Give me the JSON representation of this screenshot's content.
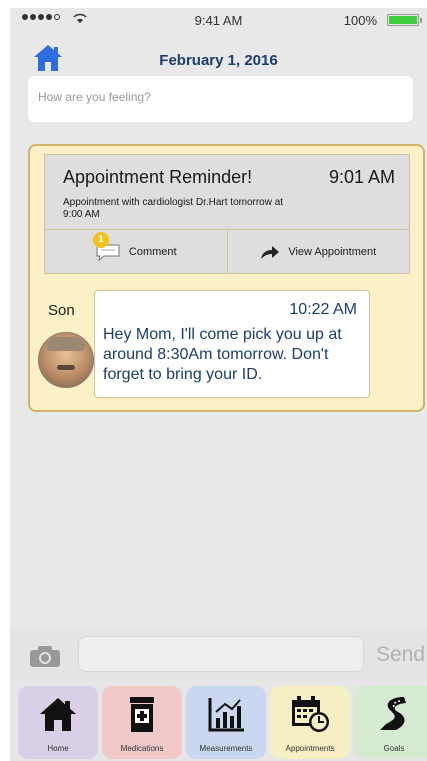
{
  "status_bar": {
    "time": "9:41 AM",
    "battery_pct": "100%",
    "battery_level": 1.0
  },
  "header": {
    "date": "February 1, 2016"
  },
  "feeling_input": {
    "placeholder": "How are you feeling?"
  },
  "reminder_card": {
    "title": "Appointment Reminder!",
    "time": "9:01 AM",
    "body": "Appointment with cardiologist Dr.Hart tomorrow at 9:00 AM",
    "comment_label": "Comment",
    "comment_badge": "1",
    "view_label": "View Appointment"
  },
  "message": {
    "sender": "Son",
    "time": "10:22 AM",
    "text": "Hey Mom, I'll come pick you up at around 8:30Am tomorrow. Don't forget to bring your ID."
  },
  "composer": {
    "send_label": "Send"
  },
  "tabs": [
    {
      "label": "Home",
      "icon": "home-icon",
      "color": "#d9cfe6"
    },
    {
      "label": "Medications",
      "icon": "medication-icon",
      "color": "#f1c9c9"
    },
    {
      "label": "Measurements",
      "icon": "chart-icon",
      "color": "#c9d8f0"
    },
    {
      "label": "Appointments",
      "icon": "calendar-clock-icon",
      "color": "#f6efc4"
    },
    {
      "label": "Goals",
      "icon": "road-icon",
      "color": "#d6ead2"
    }
  ],
  "colors": {
    "accent_blue": "#2f6de0",
    "card_bg": "#fdf0c6",
    "card_border": "#d1b467",
    "text_blue": "#1d3d6e"
  }
}
